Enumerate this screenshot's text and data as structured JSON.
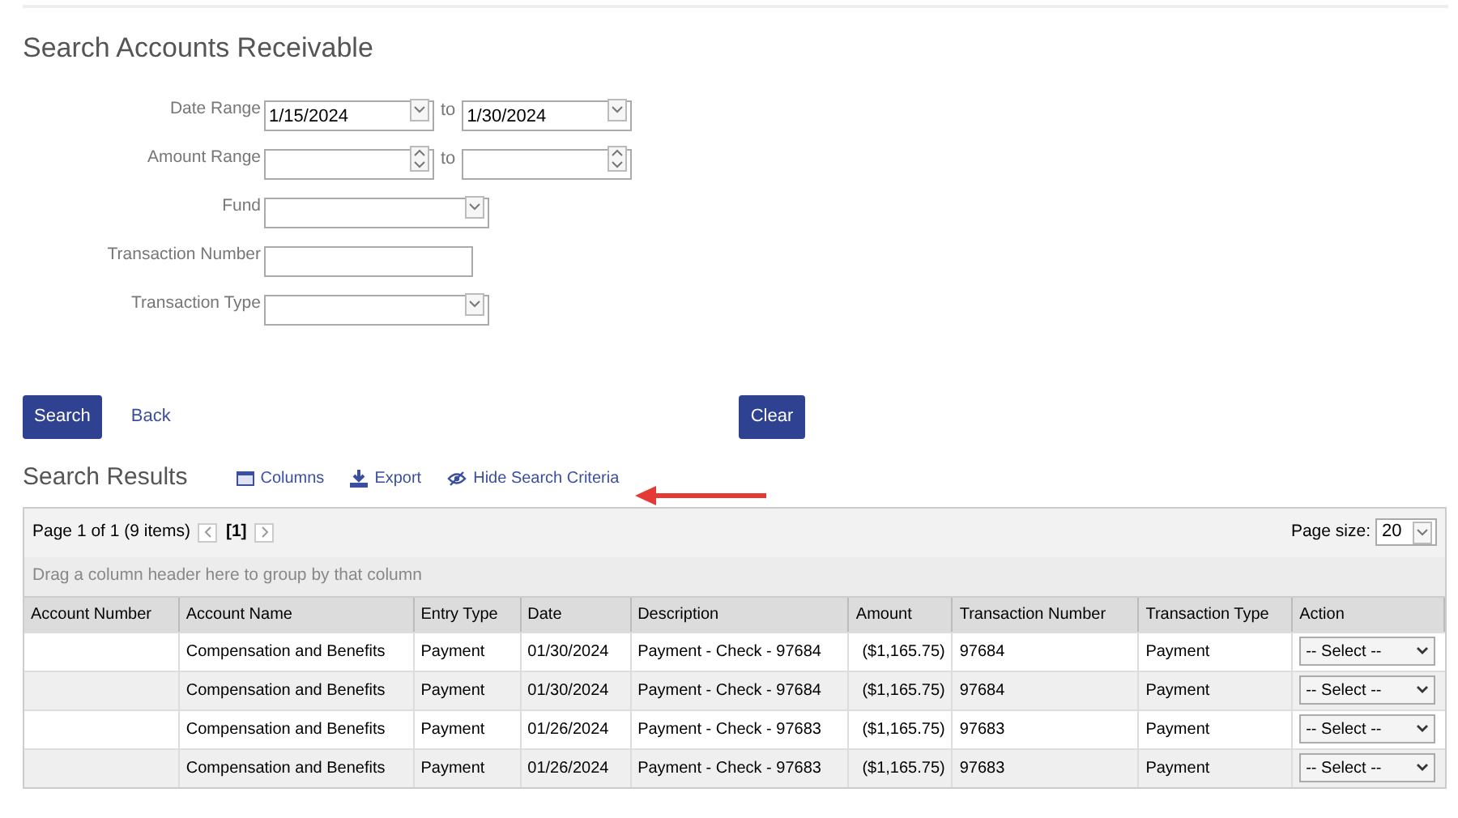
{
  "page_title": "Search Accounts Receivable",
  "form": [
    {
      "kind": "date_range",
      "label": "Date Range",
      "from": "1/15/2024",
      "separator": "to",
      "to": "1/30/2024"
    },
    {
      "kind": "number_range",
      "label": "Amount Range",
      "separator": "to"
    },
    {
      "kind": "select",
      "label": "Fund"
    },
    {
      "kind": "text",
      "label": "Transaction Number"
    },
    {
      "kind": "select",
      "label": "Transaction Type"
    }
  ],
  "buttons": {
    "search": "Search",
    "back": "Back",
    "clear": "Clear"
  },
  "results": {
    "title": "Search Results",
    "actions": [
      {
        "kind": "columns",
        "label": "Columns"
      },
      {
        "kind": "export",
        "label": "Export"
      },
      {
        "kind": "hide",
        "label": "Hide Search Criteria"
      }
    ],
    "pager": {
      "summary": "Page 1 of 1 (9 items)",
      "current": "[1]",
      "page_size_label": "Page size:",
      "page_size": "20"
    },
    "group_hint": "Drag a column header here to group by that column",
    "columns": [
      "Account Number",
      "Account Name",
      "Entry Type",
      "Date",
      "Description",
      "Amount",
      "Transaction Number",
      "Transaction Type",
      "Action"
    ],
    "rows": [
      {
        "cells": [
          "",
          "Compensation and Benefits",
          "Payment",
          "01/30/2024",
          "Payment - Check - 97684",
          "($1,165.75)",
          "97684",
          "Payment"
        ],
        "action": "-- Select --"
      },
      {
        "cells": [
          "",
          "Compensation and Benefits",
          "Payment",
          "01/30/2024",
          "Payment - Check - 97684",
          "($1,165.75)",
          "97684",
          "Payment"
        ],
        "action": "-- Select --"
      },
      {
        "cells": [
          "",
          "Compensation and Benefits",
          "Payment",
          "01/26/2024",
          "Payment - Check - 97683",
          "($1,165.75)",
          "97683",
          "Payment"
        ],
        "action": "-- Select --"
      },
      {
        "cells": [
          "",
          "Compensation and Benefits",
          "Payment",
          "01/26/2024",
          "Payment - Check - 97683",
          "($1,165.75)",
          "97683",
          "Payment"
        ],
        "action": "-- Select --"
      }
    ]
  }
}
